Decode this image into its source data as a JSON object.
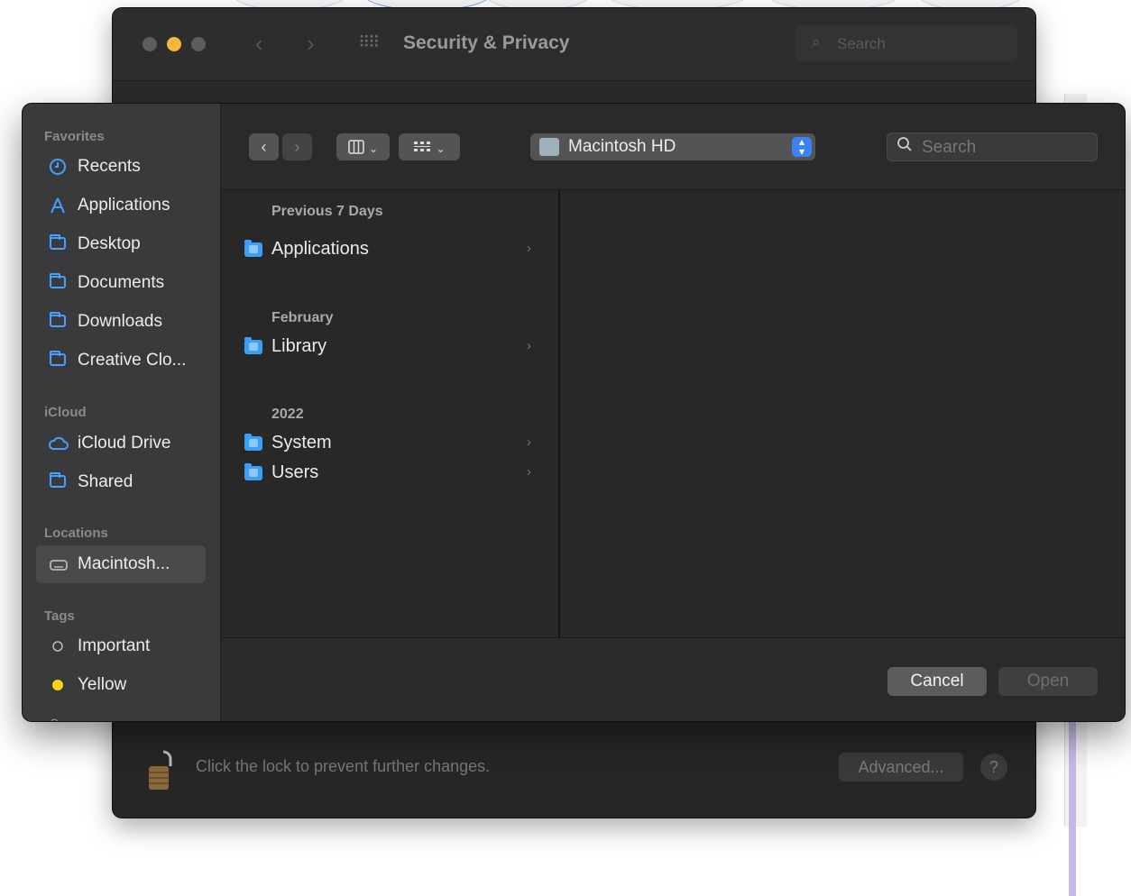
{
  "background_window": {
    "title": "Security & Privacy",
    "search_placeholder": "Search",
    "lock_text": "Click the lock to prevent further changes.",
    "advanced_label": "Advanced...",
    "help_label": "?"
  },
  "sidebar": {
    "favorites_header": "Favorites",
    "favorites": [
      {
        "label": "Recents",
        "icon": "clock-icon"
      },
      {
        "label": "Applications",
        "icon": "applications-icon"
      },
      {
        "label": "Desktop",
        "icon": "folder-icon"
      },
      {
        "label": "Documents",
        "icon": "folder-icon"
      },
      {
        "label": "Downloads",
        "icon": "folder-icon"
      },
      {
        "label": "Creative Clo...",
        "icon": "folder-icon"
      }
    ],
    "icloud_header": "iCloud",
    "icloud": [
      {
        "label": "iCloud Drive",
        "icon": "cloud-icon"
      },
      {
        "label": "Shared",
        "icon": "shared-folder-icon"
      }
    ],
    "locations_header": "Locations",
    "locations": [
      {
        "label": "Macintosh...",
        "icon": "hard-drive-icon",
        "selected": true
      }
    ],
    "tags_header": "Tags",
    "tags": [
      {
        "label": "Important",
        "color": "#000000"
      },
      {
        "label": "Yellow",
        "color": "#ffd60a"
      }
    ]
  },
  "toolbar": {
    "back_label": "‹",
    "forward_label": "›",
    "location": "Macintosh HD",
    "search_placeholder": "Search"
  },
  "browser": {
    "groups": [
      {
        "heading": "Previous 7 Days",
        "items": [
          "Applications"
        ]
      },
      {
        "heading": "February",
        "items": [
          "Library"
        ]
      },
      {
        "heading": "2022",
        "items": [
          "System",
          "Users"
        ]
      }
    ]
  },
  "footer": {
    "cancel_label": "Cancel",
    "open_label": "Open"
  },
  "colors": {
    "accent": "#3b82f6",
    "sidebar_icon": "#43a0ff",
    "tag_yellow": "#ffd60a"
  }
}
